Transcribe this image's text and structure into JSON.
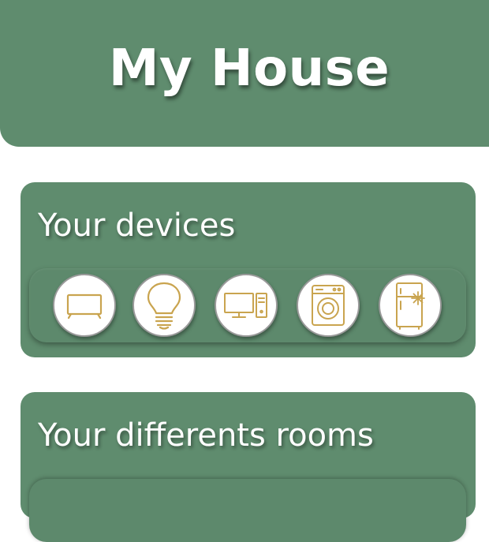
{
  "header": {
    "title": "My House"
  },
  "devices_section": {
    "title": "Your devices",
    "devices": [
      {
        "icon": "tv-icon"
      },
      {
        "icon": "lightbulb-icon"
      },
      {
        "icon": "desktop-computer-icon"
      },
      {
        "icon": "washing-machine-icon"
      },
      {
        "icon": "fridge-icon"
      }
    ]
  },
  "rooms_section": {
    "title": "Your differents rooms"
  },
  "colors": {
    "accent_green": "#5f8c6e",
    "icon_gold": "#c9a44f",
    "background": "#ffffff"
  }
}
